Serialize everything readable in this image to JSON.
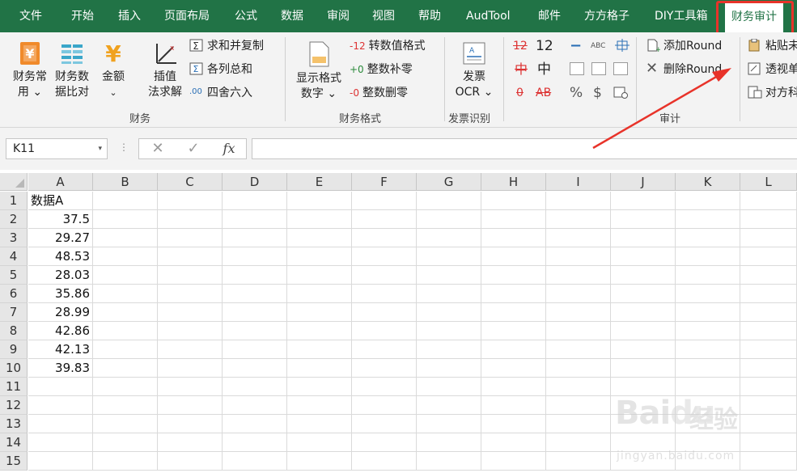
{
  "tabs": [
    {
      "label": "文件"
    },
    {
      "label": "开始"
    },
    {
      "label": "插入"
    },
    {
      "label": "页面布局"
    },
    {
      "label": "公式"
    },
    {
      "label": "数据"
    },
    {
      "label": "审阅"
    },
    {
      "label": "视图"
    },
    {
      "label": "帮助"
    },
    {
      "label": "AudTool"
    },
    {
      "label": "邮件"
    },
    {
      "label": "方方格子"
    },
    {
      "label": "DIY工具箱"
    },
    {
      "label": "财务审计"
    }
  ],
  "active_tab": "财务审计",
  "accent_color": "#217346",
  "highlight_color": "#e8332a",
  "ribbon": {
    "group_caiwu": {
      "label": "财务",
      "btn_common": {
        "line1": "财务常",
        "line2": "用 ⌄"
      },
      "btn_compare": {
        "line1": "财务数",
        "line2": "据比对"
      },
      "btn_amount": {
        "line1": "金额",
        "line2": "⌄"
      },
      "btn_interp": {
        "line1": "插值",
        "line2": "法求解"
      },
      "btn_sumcopy": "求和并复制",
      "btn_colsum": "各列总和",
      "btn_round": "四舍六入",
      "icon_round_text": ".00"
    },
    "group_format": {
      "label": "财务格式",
      "btn_display": {
        "line1": "显示格式",
        "line2": "数字 ⌄"
      },
      "btn_convert": "转数值格式",
      "btn_pad": "整数补零",
      "btn_delzero": "整数删零",
      "icon_convert": "-12",
      "icon_pad": "+0",
      "icon_delzero": "-0"
    },
    "group_invoice": {
      "label": "发票识别",
      "btn_ocr": {
        "line1": "发票",
        "line2": "OCR ⌄"
      }
    },
    "group_audit": {
      "label": "审计",
      "num_a": "12",
      "num_b": "12",
      "char_a": "中",
      "char_b": "中",
      "zero": "0",
      "ab": "AB",
      "abc": "ABC",
      "percent": "%",
      "dollar": "$",
      "btn_add_round": "添加Round",
      "btn_del_round": "删除Round",
      "btn_paste": "粘贴未",
      "btn_pivot": "透视单",
      "btn_align": "对方科"
    }
  },
  "formula_bar": {
    "name_box": "K11",
    "name_arrow": "▾",
    "dots": "⋮",
    "cancel": "✕",
    "enter": "✓",
    "fx": "fx",
    "value": ""
  },
  "sheet": {
    "columns": [
      "A",
      "B",
      "C",
      "D",
      "E",
      "F",
      "G",
      "H",
      "I",
      "J",
      "K",
      "L"
    ],
    "rows": [
      "1",
      "2",
      "3",
      "4",
      "5",
      "6",
      "7",
      "8",
      "9",
      "10",
      "11",
      "12",
      "13",
      "14",
      "15"
    ],
    "column_a": [
      "数据A",
      "37.5",
      "29.27",
      "48.53",
      "28.03",
      "35.86",
      "28.99",
      "42.86",
      "42.13",
      "39.83"
    ]
  },
  "watermark": {
    "logo": "Bai",
    "logo_du": "du",
    "jingyan": "经验",
    "url": "jingyan.baidu.com"
  }
}
